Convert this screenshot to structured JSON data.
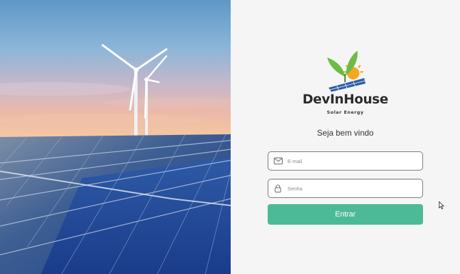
{
  "brand": {
    "name": "DevInHouse",
    "tagline": "Solar Energy",
    "logo_icon": "sprout-sun-solar-panel-logo"
  },
  "login": {
    "welcome": "Seja bem vindo",
    "email_placeholder": "E-mail",
    "email_icon": "envelope-icon",
    "password_placeholder": "Senha",
    "password_icon": "lock-icon",
    "submit_label": "Entrar"
  },
  "hero": {
    "description_icon": "wind-turbines-solar-panels-photo"
  },
  "colors": {
    "accent": "#4dba97",
    "text": "#2b2b2b",
    "background": "#f5f5f5",
    "border": "#7a7a7a"
  }
}
